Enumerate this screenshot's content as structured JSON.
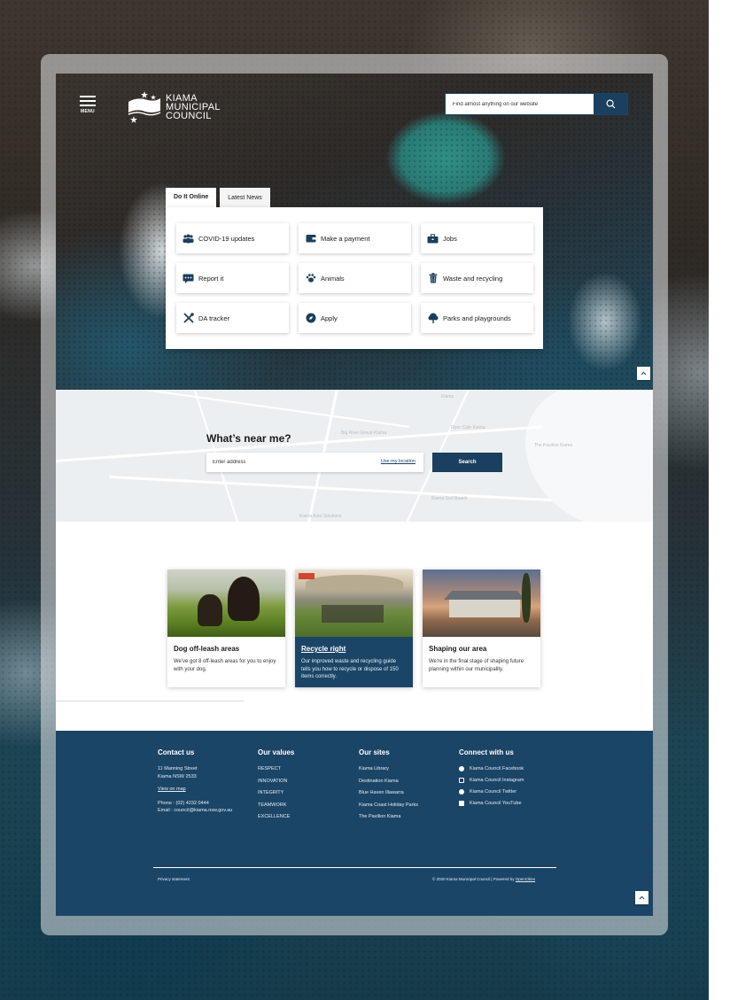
{
  "header": {
    "menu_label": "MENU",
    "logo_line1": "KIAMA",
    "logo_line2": "MUNICIPAL",
    "logo_line3": "COUNCIL",
    "search_placeholder": "Find almost anything on our website"
  },
  "tabs": [
    {
      "label": "Do It Online",
      "active": true
    },
    {
      "label": "Latest News",
      "active": false
    }
  ],
  "services": [
    {
      "label": "COVID-19 updates",
      "icon": "people-icon"
    },
    {
      "label": "Make a payment",
      "icon": "wallet-icon"
    },
    {
      "label": "Jobs",
      "icon": "briefcase-icon"
    },
    {
      "label": "Report it",
      "icon": "chat-icon"
    },
    {
      "label": "Animals",
      "icon": "paw-icon"
    },
    {
      "label": "Waste and recycling",
      "icon": "bin-icon"
    },
    {
      "label": "DA tracker",
      "icon": "tools-icon"
    },
    {
      "label": "Apply",
      "icon": "compass-icon"
    },
    {
      "label": "Parks and playgrounds",
      "icon": "tree-icon"
    }
  ],
  "near_me": {
    "title": "What’s near me?",
    "address_placeholder": "Enter address",
    "use_location": "Use my location",
    "search_label": "Search",
    "map_labels": [
      "Kiama",
      "Kiama Surf Beach",
      "The Pavilion Kiama",
      "Big River Group Kiama",
      "Kiama Auto Solutions",
      "Flyer Cafe Kiama"
    ]
  },
  "cards": [
    {
      "title": "Dog off-leash areas",
      "desc": "We've got 8 off-leash areas for you to enjoy with your dog."
    },
    {
      "title": "Recycle right",
      "desc": "Our improved waste and recycling guide tells you how to recycle or dispose of 150 items correctly."
    },
    {
      "title": "Shaping our area",
      "desc": "We're in the final stage of shaping future planning within our municipality."
    }
  ],
  "footer": {
    "contact": {
      "heading": "Contact us",
      "address1": "11 Manning Street",
      "address2": "Kiama NSW 2533",
      "map_link": "View on map",
      "phone": "Phone : (02) 4232 0444",
      "email": "Email : council@kiama.nsw.gov.au"
    },
    "values": {
      "heading": "Our values",
      "items": [
        "RESPECT",
        "INNOVATION",
        "INTEGRITY",
        "TEAMWORK",
        "EXCELLENCE"
      ]
    },
    "sites": {
      "heading": "Our sites",
      "items": [
        "Kiama Library",
        "Destination Kiama",
        "Blue Haven Illawarra",
        "Kiama Coast Holiday Parks",
        "The Pavilion Kiama"
      ]
    },
    "connect": {
      "heading": "Connect with us",
      "items": [
        "Kiama Council Facebook",
        "Kiama Council Instagram",
        "Kiama Council Twitter",
        "Kiama Council YouTube"
      ]
    },
    "privacy": "Privacy statement",
    "copyright": "© 2020 Kiama Municipal Council | Powered by",
    "powered": "OpenCities"
  },
  "colors": {
    "brand_navy": "#1b4567",
    "button_navy": "#1b3f5e"
  }
}
